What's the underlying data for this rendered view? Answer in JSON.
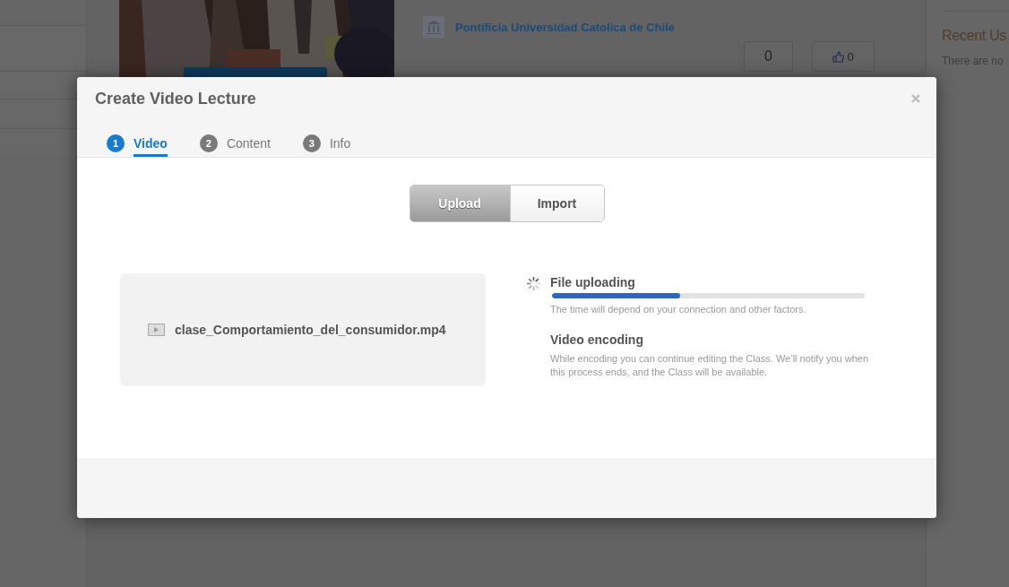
{
  "background": {
    "university": "Pontificia Universidad Catolica de Chile",
    "views": "0",
    "likes": "0",
    "sidebar_title": "Recent Us",
    "sidebar_text": "There are no"
  },
  "dialog": {
    "title": "Create Video Lecture",
    "steps": [
      {
        "number": "1",
        "label": "Video",
        "selected": true
      },
      {
        "number": "2",
        "label": "Content",
        "selected": false
      },
      {
        "number": "3",
        "label": "Info",
        "selected": false
      }
    ],
    "source_tabs": [
      {
        "label": "Upload",
        "selected": true
      },
      {
        "label": "Import",
        "selected": false
      }
    ],
    "file": {
      "name": "clase_Comportamiento_del_consumidor.mp4"
    },
    "progress": [
      {
        "kind": "upload",
        "title": "File uploading",
        "level": 0.41,
        "note": "The time will depend on your connection and other factors."
      },
      {
        "kind": "plain",
        "title": "Video encoding",
        "note": "While encoding you can continue editing the Class. We’ll notify you when this process ends, and the Class will be available."
      }
    ]
  }
}
